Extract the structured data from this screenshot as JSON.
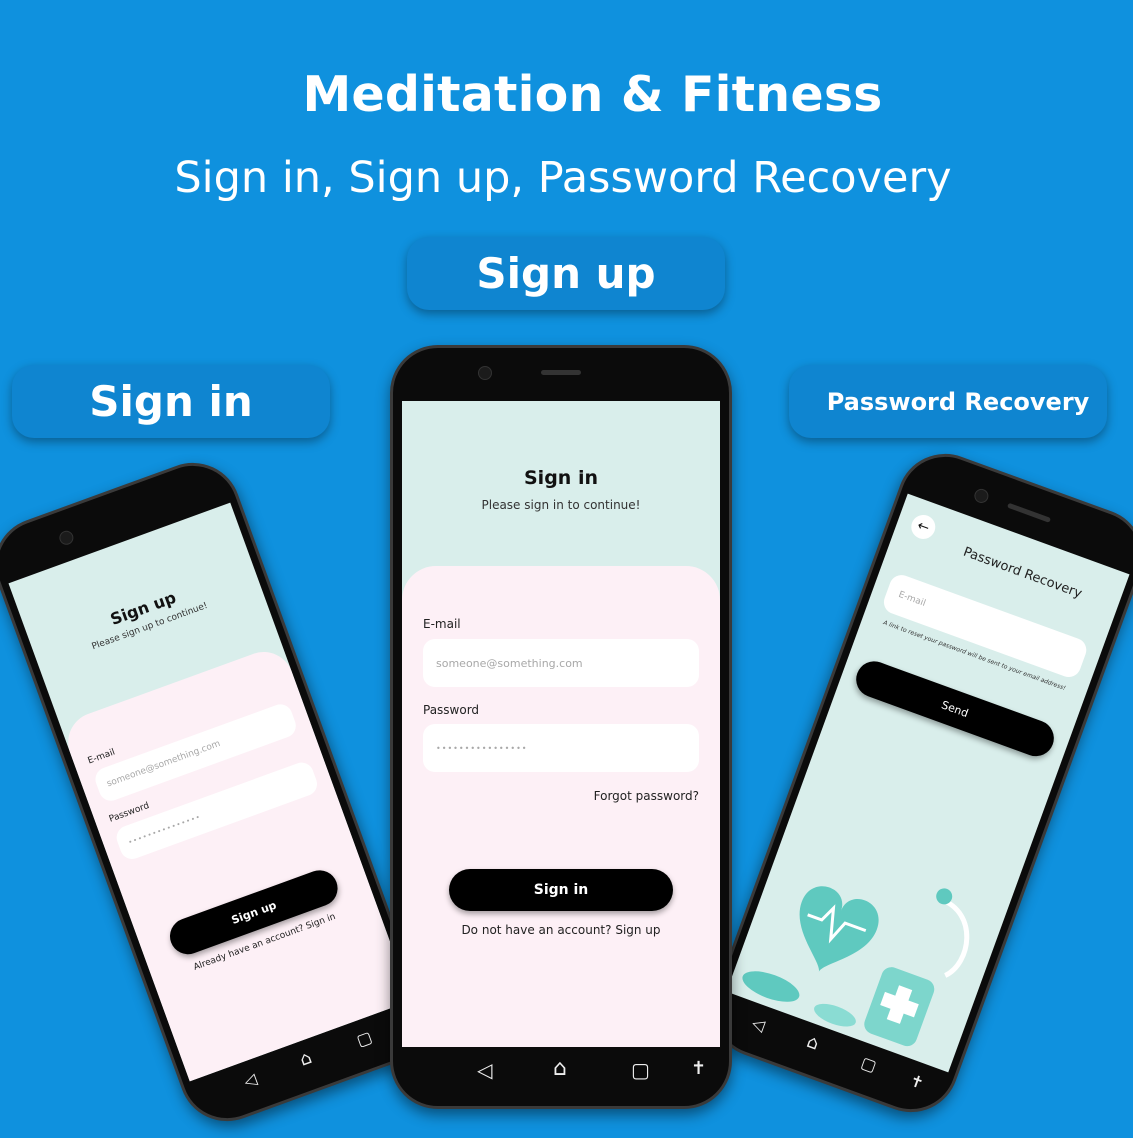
{
  "header": {
    "title": "Meditation & Fitness",
    "subtitle": "Sign in, Sign up, Password Recovery"
  },
  "pills": {
    "signup": "Sign up",
    "signin": "Sign in",
    "recovery": "Password Recovery"
  },
  "center_screen": {
    "title": "Sign in",
    "subtitle": "Please sign in to continue!",
    "email_label": "E-mail",
    "email_placeholder": "someone@something.com",
    "password_label": "Password",
    "password_mask": "••••••••••••••••",
    "forgot": "Forgot password?",
    "button": "Sign in",
    "footer": "Do not have an account? Sign up"
  },
  "left_screen": {
    "title": "Sign up",
    "subtitle": "Please sign up to continue!",
    "email_label": "E-mail",
    "email_placeholder": "someone@something.com",
    "password_label": "Password",
    "password_mask": "•••••••••••••••",
    "button": "Sign up",
    "footer": "Already have an account? Sign in"
  },
  "right_screen": {
    "title": "Password Recovery",
    "email_placeholder": "E-mail",
    "hint": "A link to reset your password will be sent to your email address!",
    "button": "Send"
  },
  "nav": {
    "back": "◁",
    "home": "⌂",
    "recent": "▢",
    "accessibility": "✝"
  },
  "colors": {
    "background": "#0f91de",
    "pill": "#0f85d0",
    "mint": "#d9eeeb",
    "pink": "#fdf0f6"
  }
}
